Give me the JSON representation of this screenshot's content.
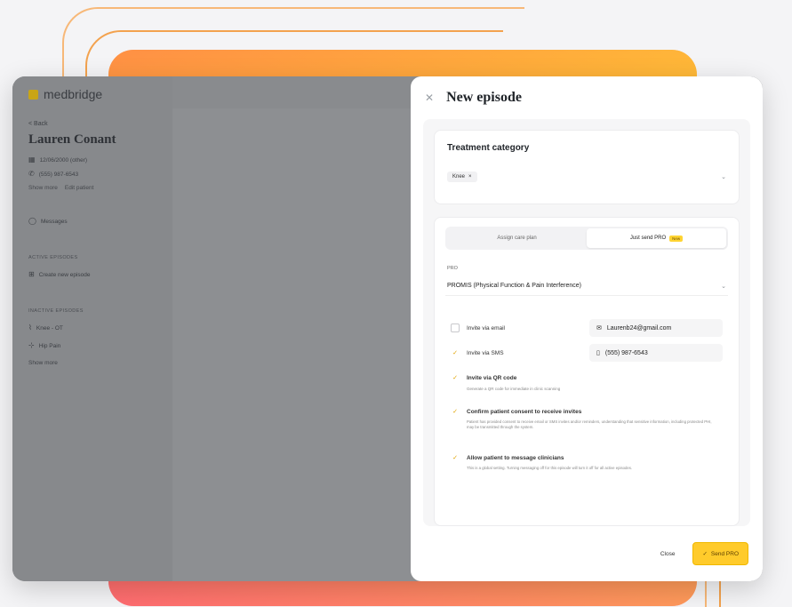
{
  "sidebar": {
    "logo": "medbridge",
    "back": "< Back",
    "patient_name": "Lauren Conant",
    "dob": "12/06/2000 (other)",
    "phone": "(555) 987-6543",
    "link_show_more": "Show more",
    "link_edit": "Edit patient",
    "messages": "Messages",
    "active_episodes_label": "ACTIVE EPISODES",
    "create_episode": "Create new episode",
    "inactive_label": "INACTIVE EPISODES",
    "episode_1": "Knee - OT",
    "episode_2": "Hip Pain",
    "show_more": "Show more"
  },
  "panel": {
    "title": "New episode",
    "treatment": {
      "title": "Treatment category",
      "chip": "Knee",
      "chip_remove": "×"
    },
    "tabs": [
      {
        "label": "Assign care plan"
      },
      {
        "label": "Just send PRO",
        "badge": "New"
      }
    ],
    "pro": {
      "label": "PRO",
      "value": "PROMIS (Physical Function & Pain Interference)"
    },
    "invites": {
      "email_label": "Invite via email",
      "email_value": "Laurenb24@gmail.com",
      "sms_label": "Invite via SMS",
      "sms_value": "(555) 987-6543",
      "qr_label": "Invite via QR code",
      "qr_desc": "Generate a QR code for immediate in clinic scanning"
    },
    "consent": {
      "title": "Confirm patient consent to receive invites",
      "desc": "Patient has provided consent to receive email or SMS invites and/or reminders, understanding that sensitive information, including protected PHI, may be transmitted through the system."
    },
    "messaging": {
      "title": "Allow patient to message clinicians",
      "desc": "This is a global setting. Turning messaging off for this episode will turn it off for all active episodes."
    },
    "footer": {
      "close": "Close",
      "send": "Send PRO"
    }
  },
  "colors": {
    "accent": "#ffcb2b",
    "check": "#e0a300"
  }
}
